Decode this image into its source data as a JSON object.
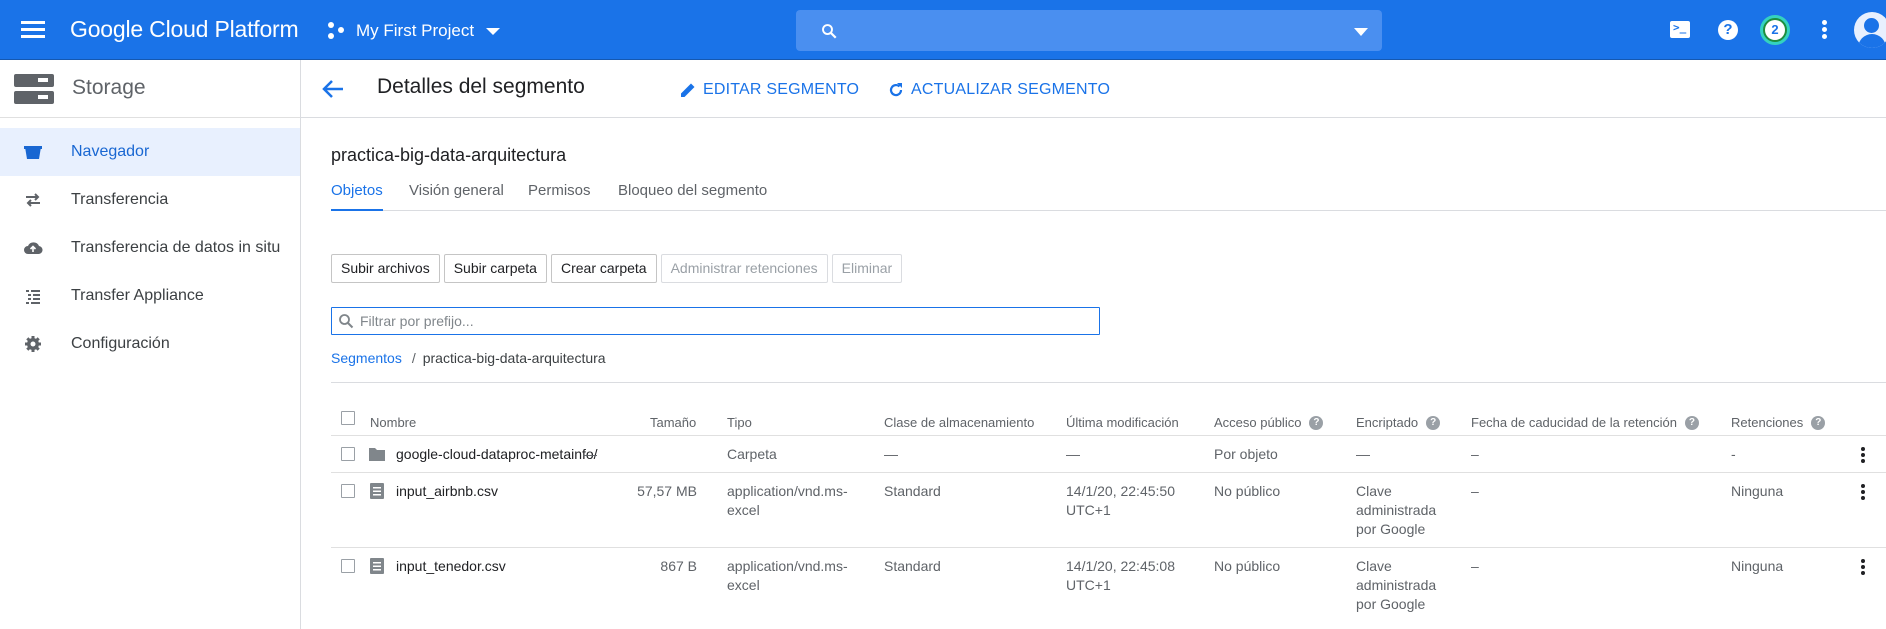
{
  "topbar": {
    "brand": "Google Cloud Platform",
    "project": "My First Project",
    "search_placeholder": "",
    "notification_count": "2",
    "brand_color": "#1a73e8"
  },
  "sidebar": {
    "title": "Storage",
    "items": [
      {
        "label": "Navegador",
        "icon": "bucket-icon",
        "active": true
      },
      {
        "label": "Transferencia",
        "icon": "swap-icon"
      },
      {
        "label": "Transferencia de datos in situ",
        "icon": "cloud-upload-icon"
      },
      {
        "label": "Transfer Appliance",
        "icon": "list-icon"
      },
      {
        "label": "Configuración",
        "icon": "gear-icon"
      }
    ]
  },
  "header": {
    "title": "Detalles del segmento",
    "edit_label": "EDITAR SEGMENTO",
    "refresh_label": "ACTUALIZAR SEGMENTO"
  },
  "bucket": {
    "name": "practica-big-data-arquitectura",
    "tabs": [
      "Objetos",
      "Visión general",
      "Permisos",
      "Bloqueo del segmento"
    ],
    "active_tab": 0
  },
  "actions": {
    "upload_files": "Subir archivos",
    "upload_folder": "Subir carpeta",
    "create_folder": "Crear carpeta",
    "manage_retention": "Administrar retenciones",
    "delete": "Eliminar"
  },
  "filter": {
    "placeholder": "Filtrar por prefijo..."
  },
  "breadcrumb": {
    "root": "Segmentos",
    "separator": "/",
    "current": "practica-big-data-arquitectura"
  },
  "table": {
    "columns": [
      "Nombre",
      "Tamaño",
      "Tipo",
      "Clase de almacenamiento",
      "Última modificación",
      "Acceso público",
      "Encriptado",
      "Fecha de caducidad de la retención",
      "Retenciones"
    ],
    "rows": [
      {
        "icon": "folder-icon",
        "name": "google-cloud-dataproc-metainfo/",
        "size": "—",
        "type": "Carpeta",
        "storage_class": "—",
        "modified": "—",
        "access": "Por objeto",
        "encrypted": "—",
        "retention_expiry": "–",
        "retentions": "-"
      },
      {
        "icon": "file-icon",
        "name": "input_airbnb.csv",
        "size": "57,57 MB",
        "type": "application/vnd.ms-excel",
        "storage_class": "Standard",
        "modified": "14/1/20, 22:45:50 UTC+1",
        "access": "No público",
        "encrypted": "Clave administrada por Google",
        "retention_expiry": "–",
        "retentions": "Ninguna"
      },
      {
        "icon": "file-icon",
        "name": "input_tenedor.csv",
        "size": "867 B",
        "type": "application/vnd.ms-excel",
        "storage_class": "Standard",
        "modified": "14/1/20, 22:45:08 UTC+1",
        "access": "No público",
        "encrypted": "Clave administrada por Google",
        "retention_expiry": "–",
        "retentions": "Ninguna"
      }
    ]
  }
}
